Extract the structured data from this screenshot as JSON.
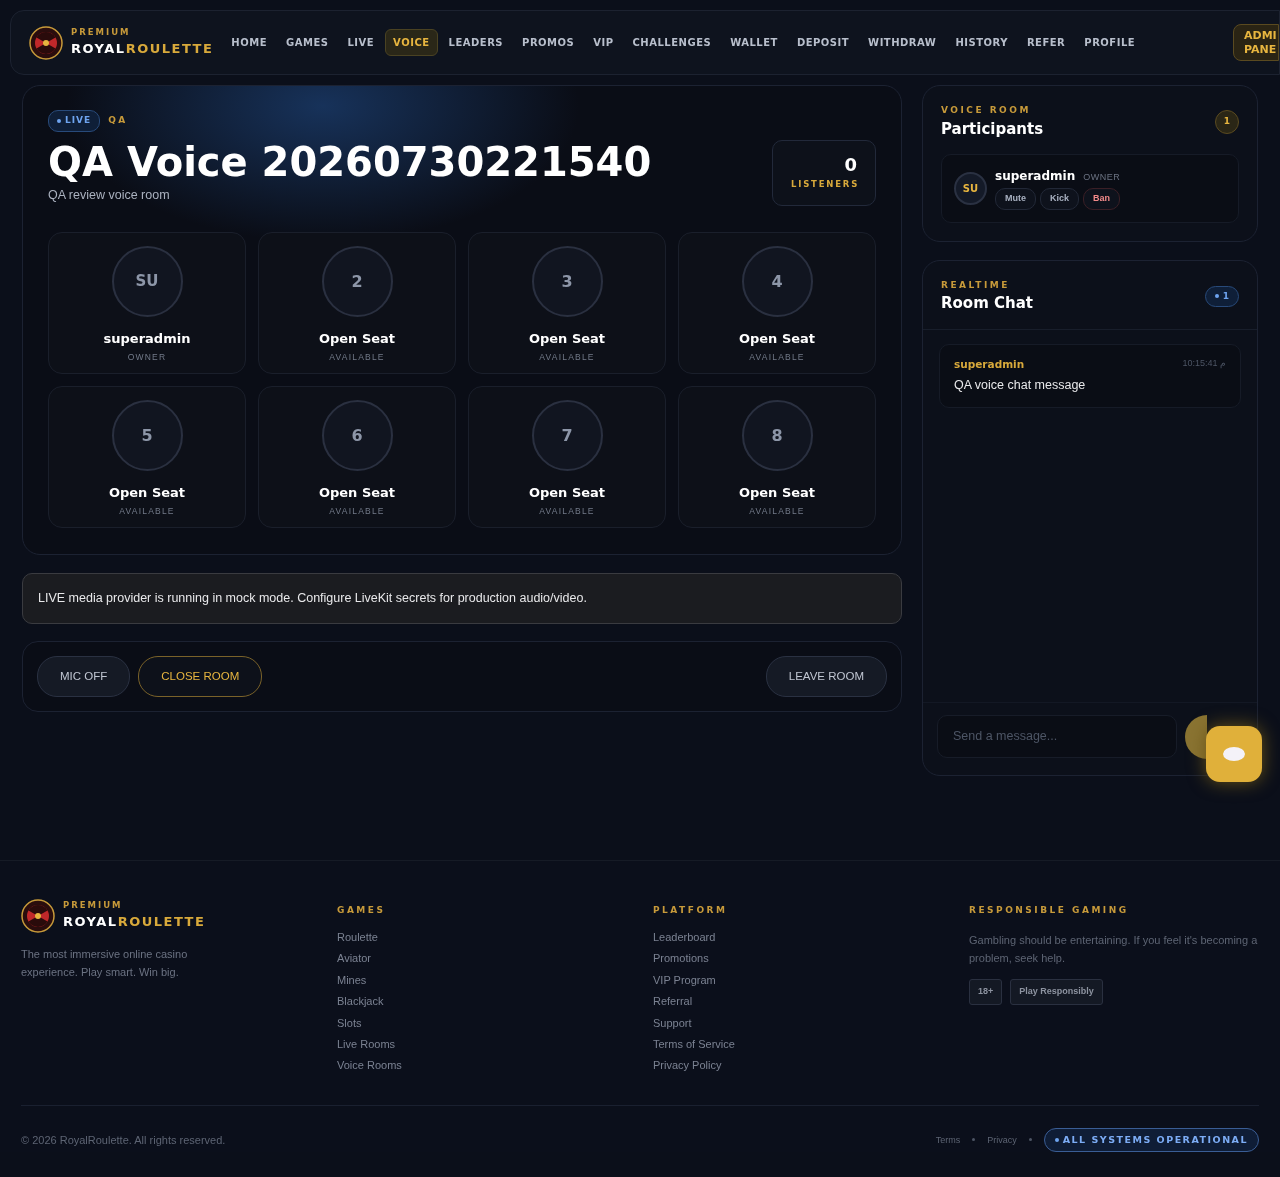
{
  "brand": {
    "tagline": "PREMIUM",
    "name_part1": "ROYAL",
    "name_part2": "ROULETTE"
  },
  "nav": [
    {
      "label": "HOME",
      "selected": false
    },
    {
      "label": "GAMES",
      "selected": false
    },
    {
      "label": "LIVE",
      "selected": false
    },
    {
      "label": "VOICE",
      "selected": true
    },
    {
      "label": "LEADERS",
      "selected": false
    },
    {
      "label": "PROMOS",
      "selected": false
    },
    {
      "label": "VIP",
      "selected": false
    },
    {
      "label": "CHALLENGES",
      "selected": false
    },
    {
      "label": "WALLET",
      "selected": false
    },
    {
      "label": "DEPOSIT",
      "selected": false
    },
    {
      "label": "WITHDRAW",
      "selected": false
    },
    {
      "label": "HISTORY",
      "selected": false
    },
    {
      "label": "REFER",
      "selected": false
    },
    {
      "label": "PROFILE",
      "selected": false
    }
  ],
  "admin_button": {
    "line1": "ADMI",
    "line2": "PANE"
  },
  "room": {
    "live_badge": "LIVE",
    "tag": "QA",
    "title": "QA Voice 20260730221540",
    "subtitle": "QA review voice room",
    "listeners_count": "0",
    "listeners_label": "LISTENERS"
  },
  "seats": [
    {
      "kind": "occupied",
      "avatar": "SU",
      "name": "superadmin",
      "role": "OWNER"
    },
    {
      "kind": "open",
      "avatar": "2",
      "name": "Open Seat",
      "role": "AVAILABLE"
    },
    {
      "kind": "open",
      "avatar": "3",
      "name": "Open Seat",
      "role": "AVAILABLE"
    },
    {
      "kind": "open",
      "avatar": "4",
      "name": "Open Seat",
      "role": "AVAILABLE"
    },
    {
      "kind": "open",
      "avatar": "5",
      "name": "Open Seat",
      "role": "AVAILABLE"
    },
    {
      "kind": "open",
      "avatar": "6",
      "name": "Open Seat",
      "role": "AVAILABLE"
    },
    {
      "kind": "open",
      "avatar": "7",
      "name": "Open Seat",
      "role": "AVAILABLE"
    },
    {
      "kind": "open",
      "avatar": "8",
      "name": "Open Seat",
      "role": "AVAILABLE"
    }
  ],
  "notice": "LIVE media provider is running in mock mode. Configure LiveKit secrets for production audio/video.",
  "controls": {
    "mic": "MIC OFF",
    "close": "CLOSE ROOM",
    "leave": "LEAVE ROOM"
  },
  "participants": {
    "eyebrow": "VOICE ROOM",
    "title": "Participants",
    "count": "1",
    "items": [
      {
        "avatar": "SU",
        "name": "superadmin",
        "role": "OWNER",
        "actions": [
          {
            "label": "Mute",
            "kind": "normal"
          },
          {
            "label": "Kick",
            "kind": "normal"
          },
          {
            "label": "Ban",
            "kind": "danger"
          }
        ]
      }
    ]
  },
  "chat": {
    "eyebrow": "REALTIME",
    "title": "Room Chat",
    "count": "1",
    "messages": [
      {
        "author": "superadmin",
        "time": "10:15:41 م",
        "text": "QA voice chat message"
      }
    ],
    "placeholder": "Send a message..."
  },
  "footer": {
    "brand": {
      "tagline": "PREMIUM",
      "name_part1": "ROYAL",
      "name_part2": "ROULETTE"
    },
    "about": "The most immersive online casino experience. Play smart. Win big.",
    "columns": [
      {
        "title": "GAMES",
        "links": [
          "Roulette",
          "Aviator",
          "Mines",
          "Blackjack",
          "Slots",
          "Live Rooms",
          "Voice Rooms"
        ]
      },
      {
        "title": "PLATFORM",
        "links": [
          "Leaderboard",
          "Promotions",
          "VIP Program",
          "Referral",
          "Support",
          "Terms of Service",
          "Privacy Policy"
        ]
      }
    ],
    "responsible": {
      "title": "RESPONSIBLE GAMING",
      "text": "Gambling should be entertaining. If you feel it's becoming a problem, seek help.",
      "badges": [
        "18+",
        "Play Responsibly"
      ]
    },
    "copyright": "© 2026 RoyalRoulette. All rights reserved.",
    "links": [
      "Terms",
      "Privacy"
    ],
    "status": "ALL SYSTEMS OPERATIONAL"
  }
}
